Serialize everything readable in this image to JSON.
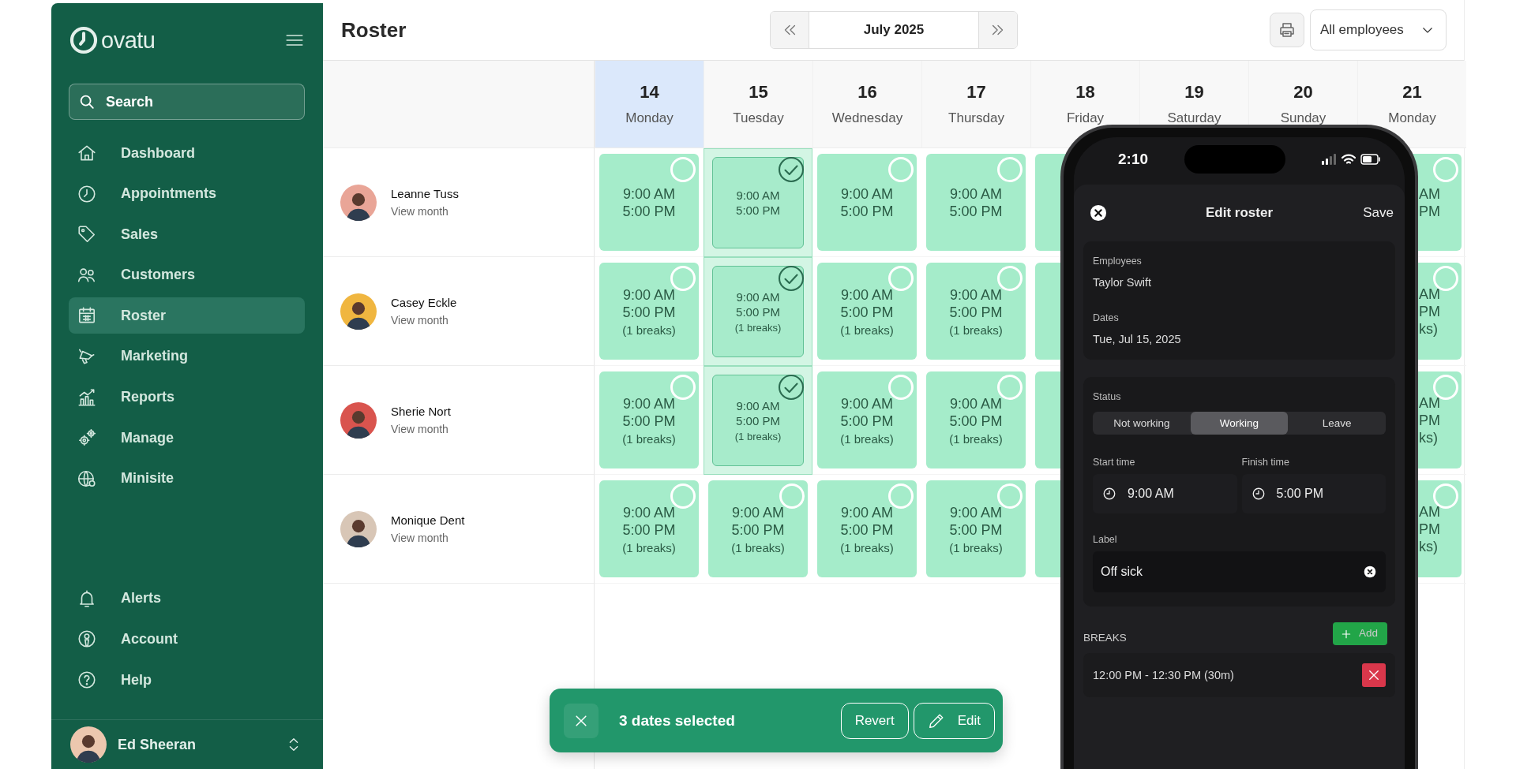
{
  "sidebar": {
    "logo": "ovatu",
    "search": {
      "placeholder": "Search"
    },
    "items": [
      {
        "label": "Dashboard",
        "selected": false
      },
      {
        "label": "Appointments",
        "selected": false
      },
      {
        "label": "Sales",
        "selected": false
      },
      {
        "label": "Customers",
        "selected": false
      },
      {
        "label": "Roster",
        "selected": true
      },
      {
        "label": "Marketing",
        "selected": false
      },
      {
        "label": "Reports",
        "selected": false
      },
      {
        "label": "Manage",
        "selected": false
      },
      {
        "label": "Minisite",
        "selected": false
      }
    ],
    "footer_items": [
      {
        "label": "Alerts"
      },
      {
        "label": "Account"
      },
      {
        "label": "Help"
      }
    ],
    "user": {
      "name": "Ed Sheeran"
    }
  },
  "header": {
    "title": "Roster",
    "month": "July 2025",
    "filter": "All employees"
  },
  "days": [
    {
      "day": "14",
      "weekday": "Monday",
      "today": true
    },
    {
      "day": "15",
      "weekday": "Tuesday",
      "today": false
    },
    {
      "day": "16",
      "weekday": "Wednesday",
      "today": false
    },
    {
      "day": "17",
      "weekday": "Thursday",
      "today": false
    },
    {
      "day": "18",
      "weekday": "Friday",
      "today": false
    },
    {
      "day": "19",
      "weekday": "Saturday",
      "today": false
    },
    {
      "day": "20",
      "weekday": "Sunday",
      "today": false
    },
    {
      "day": "21",
      "weekday": "Monday",
      "today": false
    }
  ],
  "employees": [
    {
      "name": "Leanne Tuss",
      "link": "View month",
      "shifts": [
        {
          "kind": "shift",
          "start": "9:00 AM",
          "end": "5:00 PM",
          "selected": false
        },
        {
          "kind": "shift",
          "start": "9:00 AM",
          "end": "5:00 PM",
          "selected": true
        },
        {
          "kind": "shift",
          "start": "9:00 AM",
          "end": "5:00 PM",
          "selected": false
        },
        {
          "kind": "shift",
          "start": "9:00 AM",
          "end": "5:00 PM",
          "selected": false
        },
        {
          "kind": "covered"
        },
        {
          "kind": "hidden"
        },
        {
          "kind": "hidden"
        },
        {
          "kind": "partial",
          "lines": [
            "AM",
            "PM"
          ],
          "selected": false
        }
      ]
    },
    {
      "name": "Casey Eckle",
      "link": "View month",
      "shifts": [
        {
          "kind": "shift",
          "start": "9:00 AM",
          "end": "5:00 PM",
          "breaks": "(1 breaks)",
          "selected": false
        },
        {
          "kind": "shift",
          "start": "9:00 AM",
          "end": "5:00 PM",
          "breaks": "(1 breaks)",
          "selected": true
        },
        {
          "kind": "shift",
          "start": "9:00 AM",
          "end": "5:00 PM",
          "breaks": "(1 breaks)",
          "selected": false
        },
        {
          "kind": "shift",
          "start": "9:00 AM",
          "end": "5:00 PM",
          "breaks": "(1 breaks)",
          "selected": false
        },
        {
          "kind": "covered"
        },
        {
          "kind": "hidden"
        },
        {
          "kind": "hidden"
        },
        {
          "kind": "partial",
          "lines": [
            "AM",
            "PM",
            "ks)"
          ],
          "selected": false
        }
      ]
    },
    {
      "name": "Sherie Nort",
      "link": "View month",
      "shifts": [
        {
          "kind": "shift",
          "start": "9:00 AM",
          "end": "5:00 PM",
          "breaks": "(1 breaks)",
          "selected": false
        },
        {
          "kind": "shift",
          "start": "9:00 AM",
          "end": "5:00 PM",
          "breaks": "(1 breaks)",
          "selected": true
        },
        {
          "kind": "shift",
          "start": "9:00 AM",
          "end": "5:00 PM",
          "breaks": "(1 breaks)",
          "selected": false
        },
        {
          "kind": "shift",
          "start": "9:00 AM",
          "end": "5:00 PM",
          "breaks": "(1 breaks)",
          "selected": false
        },
        {
          "kind": "covered"
        },
        {
          "kind": "hidden"
        },
        {
          "kind": "hidden"
        },
        {
          "kind": "partial",
          "lines": [
            "AM",
            "PM",
            "ks)"
          ],
          "selected": false
        }
      ]
    },
    {
      "name": "Monique Dent",
      "link": "View month",
      "shifts": [
        {
          "kind": "shift",
          "start": "9:00 AM",
          "end": "5:00 PM",
          "breaks": "(1 breaks)",
          "selected": false
        },
        {
          "kind": "shift",
          "start": "9:00 AM",
          "end": "5:00 PM",
          "breaks": "(1 breaks)",
          "selected": false
        },
        {
          "kind": "shift",
          "start": "9:00 AM",
          "end": "5:00 PM",
          "breaks": "(1 breaks)",
          "selected": false
        },
        {
          "kind": "shift",
          "start": "9:00 AM",
          "end": "5:00 PM",
          "breaks": "(1 breaks)",
          "selected": false
        },
        {
          "kind": "covered"
        },
        {
          "kind": "hidden"
        },
        {
          "kind": "hidden"
        },
        {
          "kind": "partial",
          "lines": [
            "AM",
            "PM",
            "ks)"
          ],
          "selected": false
        }
      ]
    }
  ],
  "selection_bar": {
    "text": "3 dates selected",
    "revert": "Revert",
    "edit": "Edit"
  },
  "phone": {
    "time": "2:10",
    "title": "Edit roster",
    "save": "Save",
    "fields": [
      {
        "label": "Employees",
        "value": "Taylor Swift"
      },
      {
        "label": "Dates",
        "value": "Tue, Jul 15, 2025"
      }
    ],
    "status": {
      "label": "Status",
      "options": [
        {
          "label": "Not working",
          "selected": false
        },
        {
          "label": "Working",
          "selected": true
        },
        {
          "label": "Leave",
          "selected": false
        }
      ]
    },
    "start": {
      "label": "Start time",
      "value": "9:00 AM"
    },
    "finish": {
      "label": "Finish time",
      "value": "5:00 PM"
    },
    "label_field": {
      "label": "Label",
      "value": "Off sick"
    },
    "breaks": {
      "heading": "BREAKS",
      "add": "Add",
      "items": [
        "12:00 PM - 12:30 PM (30m)"
      ]
    }
  }
}
